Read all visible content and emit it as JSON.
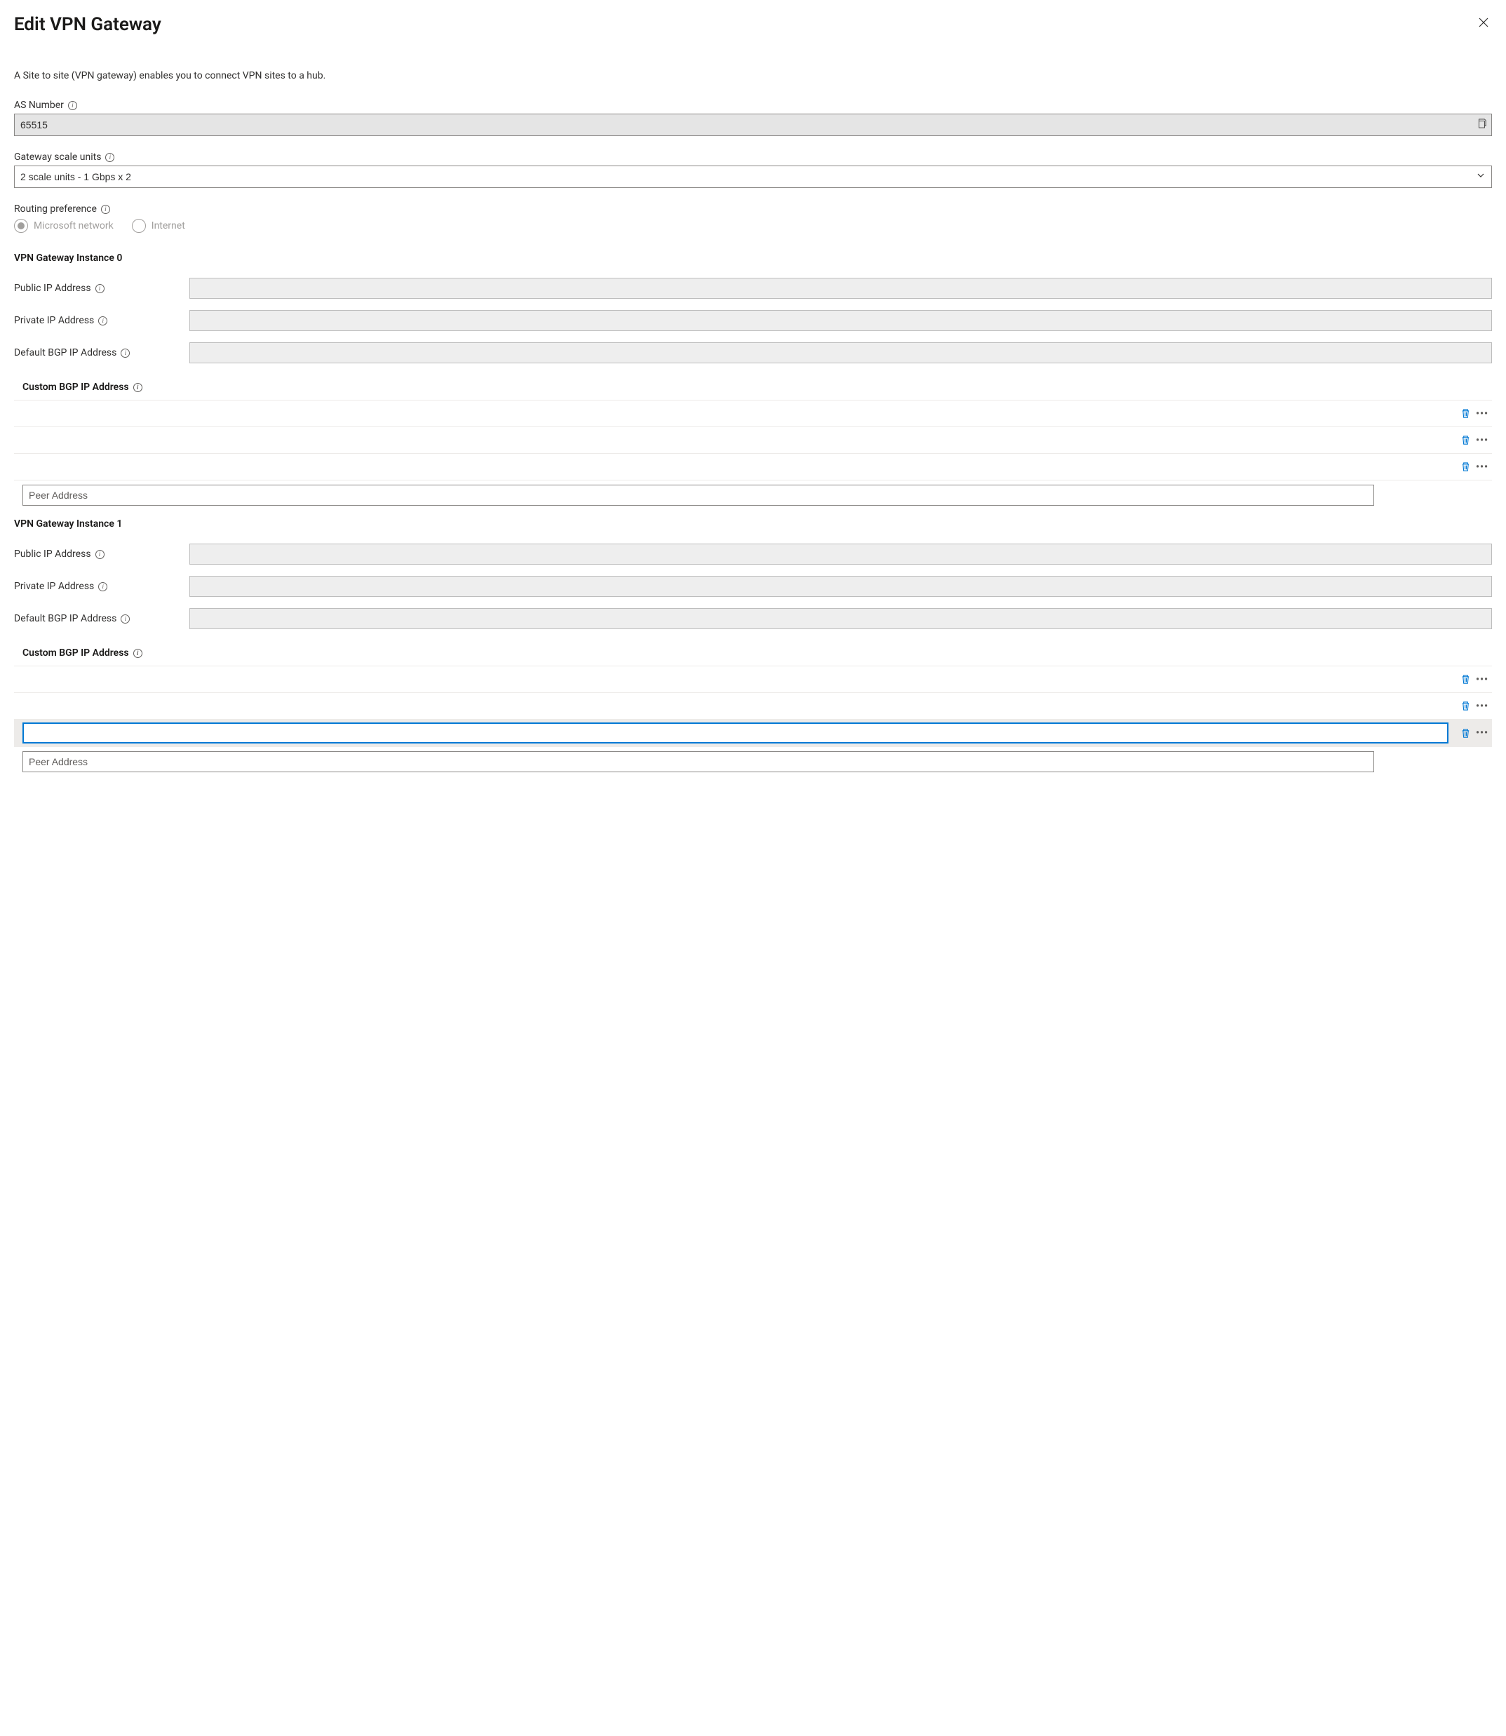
{
  "header": {
    "title": "Edit VPN Gateway"
  },
  "description": "A Site to site (VPN gateway) enables you to connect VPN sites to a hub.",
  "as_number": {
    "label": "AS Number",
    "value": "65515"
  },
  "scale_units": {
    "label": "Gateway scale units",
    "value": "2 scale units - 1 Gbps x 2"
  },
  "routing_pref": {
    "label": "Routing preference",
    "options": [
      "Microsoft network",
      "Internet"
    ],
    "selected": "Microsoft network"
  },
  "instances": [
    {
      "heading": "VPN Gateway Instance 0",
      "public_ip_label": "Public IP Address",
      "private_ip_label": "Private IP Address",
      "default_bgp_label": "Default BGP IP Address",
      "custom_bgp_label": "Custom BGP IP Address",
      "peer_placeholder": "Peer Address",
      "rows": [
        {
          "active": false,
          "value": ""
        },
        {
          "active": false,
          "value": ""
        },
        {
          "active": false,
          "value": ""
        }
      ]
    },
    {
      "heading": "VPN Gateway Instance 1",
      "public_ip_label": "Public IP Address",
      "private_ip_label": "Private IP Address",
      "default_bgp_label": "Default BGP IP Address",
      "custom_bgp_label": "Custom BGP IP Address",
      "peer_placeholder": "Peer Address",
      "rows": [
        {
          "active": false,
          "value": ""
        },
        {
          "active": false,
          "value": ""
        },
        {
          "active": true,
          "value": ""
        }
      ]
    }
  ]
}
